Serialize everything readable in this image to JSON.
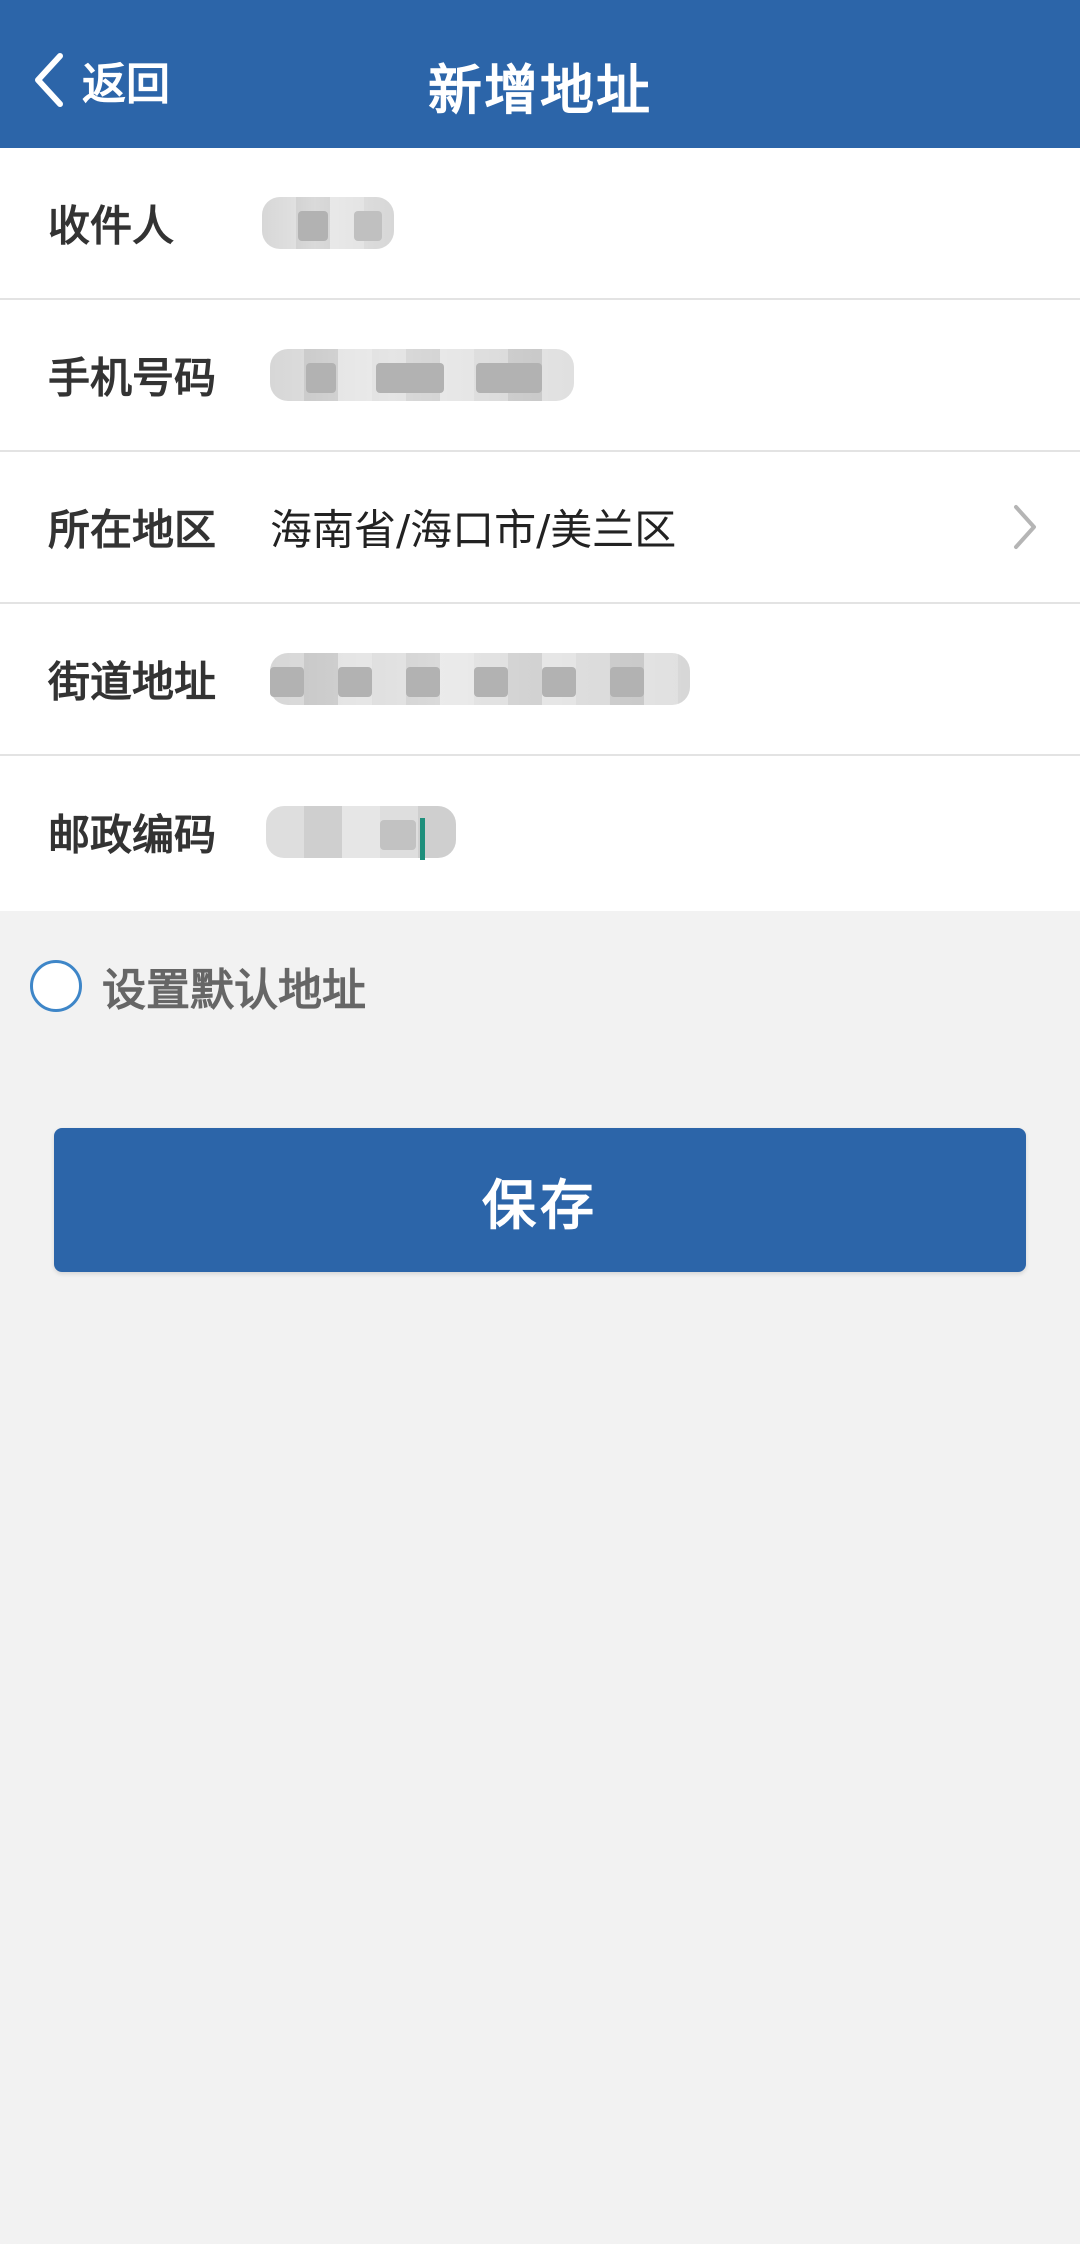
{
  "nav": {
    "back_label": "返回",
    "title": "新增地址",
    "back_icon": "chevron-left-icon"
  },
  "form": {
    "recipient_label": "收件人",
    "phone_label": "手机号码",
    "region_label": "所在地区",
    "region_value": "海南省/海口市/美兰区",
    "region_icon": "chevron-right-icon",
    "street_label": "街道地址",
    "postcode_label": "邮政编码"
  },
  "default_option": {
    "label": "设置默认地址",
    "checked": false
  },
  "save_label": "保存",
  "colors": {
    "primary": "#2c65a9",
    "background": "#f2f2f2",
    "radio_border": "#3e86c8"
  }
}
